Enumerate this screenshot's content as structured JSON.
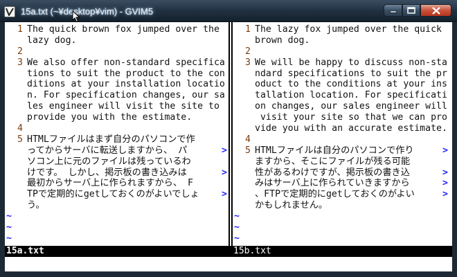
{
  "window": {
    "title": "15a.txt (~¥desktop¥vim) - GVIM5"
  },
  "left_pane": {
    "filename": "15a.txt",
    "lines": [
      {
        "num": "1",
        "text": "The quick brown fox jumped over the"
      },
      {
        "num": "",
        "text": "lazy dog."
      },
      {
        "num": "2",
        "text": ""
      },
      {
        "num": "3",
        "text": "We also offer non-standard specifica"
      },
      {
        "num": "",
        "text": "tions to suit the product to the con"
      },
      {
        "num": "",
        "text": "ditions at your installation locatio"
      },
      {
        "num": "",
        "text": "n. For specification changes, our sa"
      },
      {
        "num": "",
        "text": "les engineer will visit the site to"
      },
      {
        "num": "",
        "text": "provide you with the estimate."
      },
      {
        "num": "4",
        "text": ""
      },
      {
        "num": "5",
        "text": "HTMLファイルはまず自分のパソコンで作"
      },
      {
        "num": "",
        "text": "ってからサーバに転送しますから、 パ"
      },
      {
        "num": "",
        "text": "ソコン上に元のファイルは残っているわ"
      },
      {
        "num": "",
        "text": "けです。 しかし、掲示板の書き込みは"
      },
      {
        "num": "",
        "text": "最初からサーバ上に作られますから、 F"
      },
      {
        "num": "",
        "text": "TPで定期的にgetしておくのがよいでしょ"
      },
      {
        "num": "",
        "text": "う。"
      }
    ],
    "wrap_marks": [
      "",
      "",
      "",
      "",
      "",
      "",
      "",
      "",
      "",
      "",
      "",
      ">",
      "",
      ">",
      "",
      ">",
      ""
    ],
    "tildes": [
      "~",
      "~",
      "~"
    ]
  },
  "right_pane": {
    "filename": "15b.txt",
    "lines": [
      {
        "num": "1",
        "text": "The lazy fox jumped over the quick"
      },
      {
        "num": "",
        "text": "brown dog."
      },
      {
        "num": "2",
        "text": ""
      },
      {
        "num": "3",
        "text": "We will be happy to discuss non-sta"
      },
      {
        "num": "",
        "text": "ndard specifications to suit the pr"
      },
      {
        "num": "",
        "text": "oduct to the conditions at your ins"
      },
      {
        "num": "",
        "text": "tallation location. For specificati"
      },
      {
        "num": "",
        "text": "on changes, our sales engineer will"
      },
      {
        "num": "",
        "text": " visit your site so that we can pro"
      },
      {
        "num": "",
        "text": "vide you with an accurate estimate."
      },
      {
        "num": "4",
        "text": ""
      },
      {
        "num": "5",
        "text": "HTMLファイルは自分のパソコンで作り"
      },
      {
        "num": "",
        "text": "ますから、そこにファイルが残る可能"
      },
      {
        "num": "",
        "text": "性があるわけですが、掲示板の書き込"
      },
      {
        "num": "",
        "text": "みはサーバ上に作られていきますから"
      },
      {
        "num": "",
        "text": "、FTPで定期的にgetしておくのがよい"
      },
      {
        "num": "",
        "text": "かもしれません。"
      }
    ],
    "wrap_marks": [
      "",
      "",
      "",
      "",
      "",
      "",
      "",
      "",
      "",
      "",
      "",
      ">",
      "",
      ">",
      ">",
      ">",
      ""
    ],
    "tildes": [
      "~",
      "~",
      "~"
    ]
  }
}
